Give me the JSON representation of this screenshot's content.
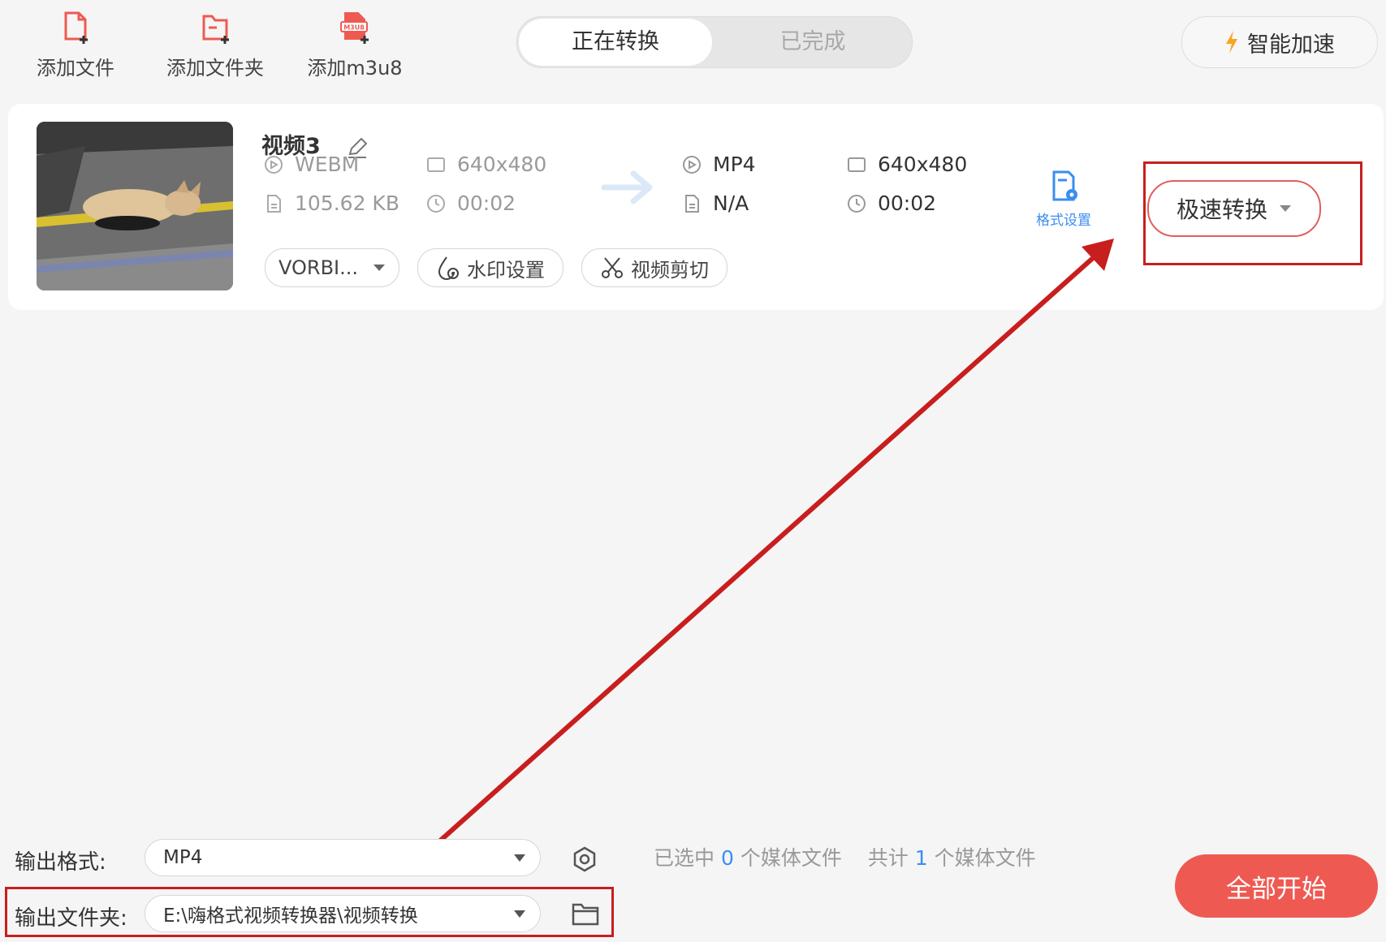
{
  "toolbar": {
    "add_file": "添加文件",
    "add_folder": "添加文件夹",
    "add_m3u8": "添加m3u8",
    "m3u8_badge": "M3U8"
  },
  "tabs": {
    "converting": "正在转换",
    "completed": "已完成"
  },
  "smart_accel": "智能加速",
  "file": {
    "name": "视频3",
    "src_format": "WEBM",
    "src_resolution": "640x480",
    "src_size": "105.62 KB",
    "src_duration": "00:02",
    "dst_format": "MP4",
    "dst_resolution": "640x480",
    "dst_size": "N/A",
    "dst_duration": "00:02",
    "audio_track": "VORBI...",
    "watermark": "水印设置",
    "trim": "视频剪切",
    "format_settings": "格式设置",
    "speed_convert": "极速转换"
  },
  "bottom": {
    "output_format_label": "输出格式:",
    "output_format_value": "MP4",
    "output_folder_label": "输出文件夹:",
    "output_folder_value": "E:\\嗨格式视频转换器\\视频转换",
    "selected_prefix": "已选中",
    "selected_count": "0",
    "selected_suffix": "个媒体文件",
    "total_prefix": "共计",
    "total_count": "1",
    "total_suffix": "个媒体文件",
    "start_all": "全部开始"
  },
  "colors": {
    "accent_red": "#ee5a52",
    "annotation_red": "#c81e1e",
    "link_blue": "#3b8ef0"
  }
}
